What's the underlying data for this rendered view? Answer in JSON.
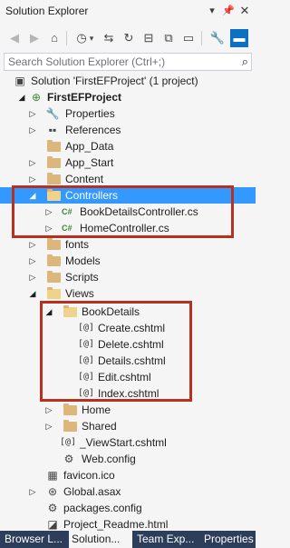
{
  "window": {
    "title": "Solution Explorer",
    "pin_icon": "pin-icon",
    "close_icon": "close-icon",
    "dropdown_icon": "chevron-down-icon"
  },
  "search": {
    "placeholder": "Search Solution Explorer (Ctrl+;)"
  },
  "tree": {
    "solution": "Solution 'FirstEFProject' (1 project)",
    "project": "FirstEFProject",
    "properties": "Properties",
    "references": "References",
    "app_data": "App_Data",
    "app_start": "App_Start",
    "content": "Content",
    "controllers": "Controllers",
    "book_details_controller": "BookDetailsController.cs",
    "home_controller": "HomeController.cs",
    "fonts": "fonts",
    "models": "Models",
    "scripts": "Scripts",
    "views": "Views",
    "book_details": "BookDetails",
    "create": "Create.cshtml",
    "delete": "Delete.cshtml",
    "details": "Details.cshtml",
    "edit": "Edit.cshtml",
    "index": "Index.cshtml",
    "home": "Home",
    "shared": "Shared",
    "viewstart": "_ViewStart.cshtml",
    "web_config_views": "Web.config",
    "favicon": "favicon.ico",
    "global_asax": "Global.asax",
    "packages_config": "packages.config",
    "project_readme": "Project_Readme.html",
    "cs_badge": "C#"
  },
  "tabs": [
    {
      "label": "Browser L..."
    },
    {
      "label": "Solution..."
    },
    {
      "label": "Team Exp..."
    },
    {
      "label": "Properties"
    }
  ],
  "colors": {
    "selection": "#3399ff",
    "callout": "#b8311f",
    "tab_bar": "#2d3e5b"
  }
}
